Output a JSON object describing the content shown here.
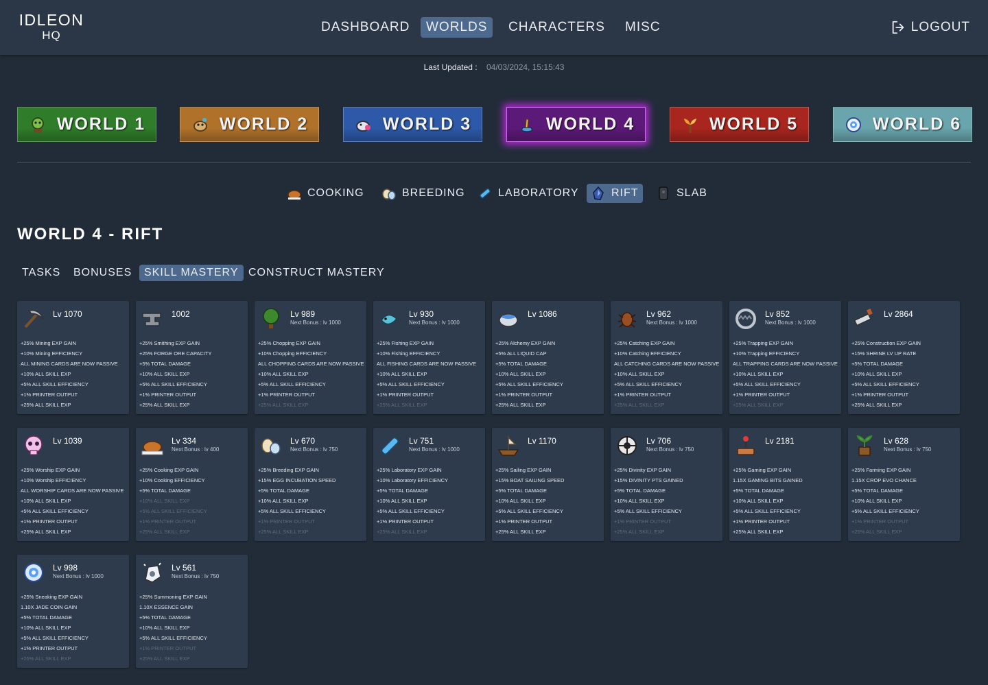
{
  "logo": {
    "top": "IDLEON",
    "bottom": "HQ"
  },
  "nav": {
    "items": [
      {
        "label": "DASHBOARD",
        "active": false
      },
      {
        "label": "WORLDS",
        "active": true
      },
      {
        "label": "CHARACTERS",
        "active": false
      },
      {
        "label": "MISC",
        "active": false
      }
    ],
    "logout": "LOGOUT"
  },
  "last_updated": {
    "label": "Last Updated :",
    "value": "04/03/2024, 15:15:43"
  },
  "worlds": [
    {
      "label": "WORLD 1",
      "icon": "goblin-icon",
      "selected": false
    },
    {
      "label": "WORLD 2",
      "icon": "desert-creature-icon",
      "selected": false
    },
    {
      "label": "WORLD 3",
      "icon": "snow-creature-icon",
      "selected": false
    },
    {
      "label": "WORLD 4",
      "icon": "space-creature-icon",
      "selected": true
    },
    {
      "label": "WORLD 5",
      "icon": "fire-sprout-icon",
      "selected": false
    },
    {
      "label": "WORLD 6",
      "icon": "spirit-flower-icon",
      "selected": false
    }
  ],
  "world_colors": [
    "#2f7d2a",
    "#b0722b",
    "#2d59a8",
    "#5c1a78",
    "#a8261e",
    "#6aa5ad"
  ],
  "subnav": [
    {
      "label": "COOKING",
      "icon": "turkey-icon",
      "active": false
    },
    {
      "label": "BREEDING",
      "icon": "egg-icon",
      "active": false
    },
    {
      "label": "LABORATORY",
      "icon": "vial-icon",
      "active": false
    },
    {
      "label": "RIFT",
      "icon": "rift-crystal-icon",
      "active": true
    },
    {
      "label": "SLAB",
      "icon": "slab-icon",
      "active": false
    }
  ],
  "page_title": "WORLD 4 - RIFT",
  "tabs": [
    {
      "label": "TASKS",
      "active": false
    },
    {
      "label": "BONUSES",
      "active": false
    },
    {
      "label": "SKILL MASTERY",
      "active": true
    },
    {
      "label": "CONSTRUCT MASTERY",
      "active": false
    }
  ],
  "skills": [
    {
      "icon": "pickaxe-icon",
      "level": "Lv 1070",
      "next": "",
      "bonuses": [
        {
          "text": "+25% Mining EXP GAIN",
          "active": true
        },
        {
          "text": "+10% Mining EFFICIENCY",
          "active": true
        },
        {
          "text": "ALL MINING CARDS ARE NOW PASSIVE",
          "active": true
        },
        {
          "text": "+10% ALL SKILL EXP",
          "active": true
        },
        {
          "text": "+5% ALL SKILL EFFICIENCY",
          "active": true
        },
        {
          "text": "+1% PRINTER OUTPUT",
          "active": true
        },
        {
          "text": "+25% ALL SKILL EXP",
          "active": true
        }
      ]
    },
    {
      "icon": "anvil-icon",
      "level": "1002",
      "next": "",
      "bonuses": [
        {
          "text": "+25% Smithing EXP GAIN",
          "active": true
        },
        {
          "text": "+25% FORGE ORE CAPACITY",
          "active": true
        },
        {
          "text": "+5% TOTAL DAMAGE",
          "active": true
        },
        {
          "text": "+10% ALL SKILL EXP",
          "active": true
        },
        {
          "text": "+5% ALL SKILL EFFICIENCY",
          "active": true
        },
        {
          "text": "+1% PRINTER OUTPUT",
          "active": true
        },
        {
          "text": "+25% ALL SKILL EXP",
          "active": true
        }
      ]
    },
    {
      "icon": "tree-icon",
      "level": "Lv 989",
      "next": "Next Bonus : lv 1000",
      "bonuses": [
        {
          "text": "+25% Chopping EXP GAIN",
          "active": true
        },
        {
          "text": "+10% Chopping EFFICIENCY",
          "active": true
        },
        {
          "text": "ALL CHOPPING CARDS ARE NOW PASSIVE",
          "active": true
        },
        {
          "text": "+10% ALL SKILL EXP",
          "active": true
        },
        {
          "text": "+5% ALL SKILL EFFICIENCY",
          "active": true
        },
        {
          "text": "+1% PRINTER OUTPUT",
          "active": true
        },
        {
          "text": "+25% ALL SKILL EXP",
          "active": false
        }
      ]
    },
    {
      "icon": "fish-icon",
      "level": "Lv 930",
      "next": "Next Bonus : lv 1000",
      "bonuses": [
        {
          "text": "+25% Fishing EXP GAIN",
          "active": true
        },
        {
          "text": "+10% Fishing EFFICIENCY",
          "active": true
        },
        {
          "text": "ALL FISHING CARDS ARE NOW PASSIVE",
          "active": true
        },
        {
          "text": "+10% ALL SKILL EXP",
          "active": true
        },
        {
          "text": "+5% ALL SKILL EFFICIENCY",
          "active": true
        },
        {
          "text": "+1% PRINTER OUTPUT",
          "active": true
        },
        {
          "text": "+25% ALL SKILL EXP",
          "active": false
        }
      ]
    },
    {
      "icon": "cauldron-icon",
      "level": "Lv 1086",
      "next": "",
      "bonuses": [
        {
          "text": "+25% Alchemy EXP GAIN",
          "active": true
        },
        {
          "text": "+5% ALL LIQUID CAP",
          "active": true
        },
        {
          "text": "+5% TOTAL DAMAGE",
          "active": true
        },
        {
          "text": "+10% ALL SKILL EXP",
          "active": true
        },
        {
          "text": "+5% ALL SKILL EFFICIENCY",
          "active": true
        },
        {
          "text": "+1% PRINTER OUTPUT",
          "active": true
        },
        {
          "text": "+25% ALL SKILL EXP",
          "active": true
        }
      ]
    },
    {
      "icon": "bug-icon",
      "level": "Lv 962",
      "next": "Next Bonus : lv 1000",
      "bonuses": [
        {
          "text": "+25% Catching EXP GAIN",
          "active": true
        },
        {
          "text": "+10% Catching EFFICIENCY",
          "active": true
        },
        {
          "text": "ALL CATCHING CARDS ARE NOW PASSIVE",
          "active": true
        },
        {
          "text": "+10% ALL SKILL EXP",
          "active": true
        },
        {
          "text": "+5% ALL SKILL EFFICIENCY",
          "active": true
        },
        {
          "text": "+1% PRINTER OUTPUT",
          "active": true
        },
        {
          "text": "+25% ALL SKILL EXP",
          "active": false
        }
      ]
    },
    {
      "icon": "trap-icon",
      "level": "Lv 852",
      "next": "Next Bonus : lv 1000",
      "bonuses": [
        {
          "text": "+25% Trapping EXP GAIN",
          "active": true
        },
        {
          "text": "+10% Trapping EFFICIENCY",
          "active": true
        },
        {
          "text": "ALL TRAPPING CARDS ARE NOW PASSIVE",
          "active": true
        },
        {
          "text": "+10% ALL SKILL EXP",
          "active": true
        },
        {
          "text": "+5% ALL SKILL EFFICIENCY",
          "active": true
        },
        {
          "text": "+1% PRINTER OUTPUT",
          "active": true
        },
        {
          "text": "+25% ALL SKILL EXP",
          "active": false
        }
      ]
    },
    {
      "icon": "saw-icon",
      "level": "Lv 2864",
      "next": "",
      "bonuses": [
        {
          "text": "+25% Construction EXP GAIN",
          "active": true
        },
        {
          "text": "+15% SHRINE LV UP RATE",
          "active": true
        },
        {
          "text": "+5% TOTAL DAMAGE",
          "active": true
        },
        {
          "text": "+10% ALL SKILL EXP",
          "active": true
        },
        {
          "text": "+5% ALL SKILL EFFICIENCY",
          "active": true
        },
        {
          "text": "+1% PRINTER OUTPUT",
          "active": true
        },
        {
          "text": "+25% ALL SKILL EXP",
          "active": true
        }
      ]
    },
    {
      "icon": "skull-icon",
      "level": "Lv 1039",
      "next": "",
      "bonuses": [
        {
          "text": "+25% Worship EXP GAIN",
          "active": true
        },
        {
          "text": "+10% Worship EFFICIENCY",
          "active": true
        },
        {
          "text": "ALL WORSHIP CARDS ARE NOW PASSIVE",
          "active": true
        },
        {
          "text": "+10% ALL SKILL EXP",
          "active": true
        },
        {
          "text": "+5% ALL SKILL EFFICIENCY",
          "active": true
        },
        {
          "text": "+1% PRINTER OUTPUT",
          "active": true
        },
        {
          "text": "+25% ALL SKILL EXP",
          "active": true
        }
      ]
    },
    {
      "icon": "roast-turkey-icon",
      "level": "Lv 334",
      "next": "Next Bonus : lv 400",
      "bonuses": [
        {
          "text": "+25% Cooking EXP GAIN",
          "active": true
        },
        {
          "text": "+10% Cooking EFFICIENCY",
          "active": true
        },
        {
          "text": "+5% TOTAL DAMAGE",
          "active": true
        },
        {
          "text": "+10% ALL SKILL EXP",
          "active": false
        },
        {
          "text": "+5% ALL SKILL EFFICIENCY",
          "active": false
        },
        {
          "text": "+1% PRINTER OUTPUT",
          "active": false
        },
        {
          "text": "+25% ALL SKILL EXP",
          "active": false
        }
      ]
    },
    {
      "icon": "eggs-icon",
      "level": "Lv 670",
      "next": "Next Bonus : lv 750",
      "bonuses": [
        {
          "text": "+25% Breeding EXP GAIN",
          "active": true
        },
        {
          "text": "+15% EGG INCUBATION SPEED",
          "active": true
        },
        {
          "text": "+5% TOTAL DAMAGE",
          "active": true
        },
        {
          "text": "+10% ALL SKILL EXP",
          "active": true
        },
        {
          "text": "+5% ALL SKILL EFFICIENCY",
          "active": true
        },
        {
          "text": "+1% PRINTER OUTPUT",
          "active": false
        },
        {
          "text": "+25% ALL SKILL EXP",
          "active": false
        }
      ]
    },
    {
      "icon": "test-tube-icon",
      "level": "Lv 751",
      "next": "Next Bonus : lv 1000",
      "bonuses": [
        {
          "text": "+25% Laboratory EXP GAIN",
          "active": true
        },
        {
          "text": "+10% Laboratory EFFICIENCY",
          "active": true
        },
        {
          "text": "+5% TOTAL DAMAGE",
          "active": true
        },
        {
          "text": "+10% ALL SKILL EXP",
          "active": true
        },
        {
          "text": "+5% ALL SKILL EFFICIENCY",
          "active": true
        },
        {
          "text": "+1% PRINTER OUTPUT",
          "active": true
        },
        {
          "text": "+25% ALL SKILL EXP",
          "active": false
        }
      ]
    },
    {
      "icon": "ship-icon",
      "level": "Lv 1170",
      "next": "",
      "bonuses": [
        {
          "text": "+25% Sailing EXP GAIN",
          "active": true
        },
        {
          "text": "+15% BOAT SAILING SPEED",
          "active": true
        },
        {
          "text": "+5% TOTAL DAMAGE",
          "active": true
        },
        {
          "text": "+10% ALL SKILL EXP",
          "active": true
        },
        {
          "text": "+5% ALL SKILL EFFICIENCY",
          "active": true
        },
        {
          "text": "+1% PRINTER OUTPUT",
          "active": true
        },
        {
          "text": "+25% ALL SKILL EXP",
          "active": true
        }
      ]
    },
    {
      "icon": "divinity-wheel-icon",
      "level": "Lv 706",
      "next": "Next Bonus : lv 750",
      "bonuses": [
        {
          "text": "+25% Divinity EXP GAIN",
          "active": true
        },
        {
          "text": "+15% DIVINITY PTS GAINED",
          "active": true
        },
        {
          "text": "+5% TOTAL DAMAGE",
          "active": true
        },
        {
          "text": "+10% ALL SKILL EXP",
          "active": true
        },
        {
          "text": "+5% ALL SKILL EFFICIENCY",
          "active": true
        },
        {
          "text": "+1% PRINTER OUTPUT",
          "active": false
        },
        {
          "text": "+25% ALL SKILL EXP",
          "active": false
        }
      ]
    },
    {
      "icon": "joystick-icon",
      "level": "Lv 2181",
      "next": "",
      "bonuses": [
        {
          "text": "+25% Gaming EXP GAIN",
          "active": true
        },
        {
          "text": "1.15X GAMING BITS GAINED",
          "active": true
        },
        {
          "text": "+5% TOTAL DAMAGE",
          "active": true
        },
        {
          "text": "+10% ALL SKILL EXP",
          "active": true
        },
        {
          "text": "+5% ALL SKILL EFFICIENCY",
          "active": true
        },
        {
          "text": "+1% PRINTER OUTPUT",
          "active": true
        },
        {
          "text": "+25% ALL SKILL EXP",
          "active": true
        }
      ]
    },
    {
      "icon": "seedling-icon",
      "level": "Lv 628",
      "next": "Next Bonus : lv 750",
      "bonuses": [
        {
          "text": "+25% Farming EXP GAIN",
          "active": true
        },
        {
          "text": "1.15X CROP EVO CHANCE",
          "active": true
        },
        {
          "text": "+5% TOTAL DAMAGE",
          "active": true
        },
        {
          "text": "+10% ALL SKILL EXP",
          "active": true
        },
        {
          "text": "+5% ALL SKILL EFFICIENCY",
          "active": true
        },
        {
          "text": "+1% PRINTER OUTPUT",
          "active": false
        },
        {
          "text": "+25% ALL SKILL EXP",
          "active": false
        }
      ]
    },
    {
      "icon": "sneaking-orb-icon",
      "level": "Lv 998",
      "next": "Next Bonus : lv 1000",
      "bonuses": [
        {
          "text": "+25% Sneaking EXP GAIN",
          "active": true
        },
        {
          "text": "1.10X JADE COIN GAIN",
          "active": true
        },
        {
          "text": "+5% TOTAL DAMAGE",
          "active": true
        },
        {
          "text": "+10% ALL SKILL EXP",
          "active": true
        },
        {
          "text": "+5% ALL SKILL EFFICIENCY",
          "active": true
        },
        {
          "text": "+1% PRINTER OUTPUT",
          "active": true
        },
        {
          "text": "+25% ALL SKILL EXP",
          "active": false
        }
      ]
    },
    {
      "icon": "summoning-essence-icon",
      "level": "Lv 561",
      "next": "Next Bonus : lv 750",
      "bonuses": [
        {
          "text": "+25% Summoning EXP GAIN",
          "active": true
        },
        {
          "text": "1.10X ESSENCE GAIN",
          "active": true
        },
        {
          "text": "+5% TOTAL DAMAGE",
          "active": true
        },
        {
          "text": "+10% ALL SKILL EXP",
          "active": true
        },
        {
          "text": "+5% ALL SKILL EFFICIENCY",
          "active": true
        },
        {
          "text": "+1% PRINTER OUTPUT",
          "active": false
        },
        {
          "text": "+25% ALL SKILL EXP",
          "active": false
        }
      ]
    }
  ]
}
